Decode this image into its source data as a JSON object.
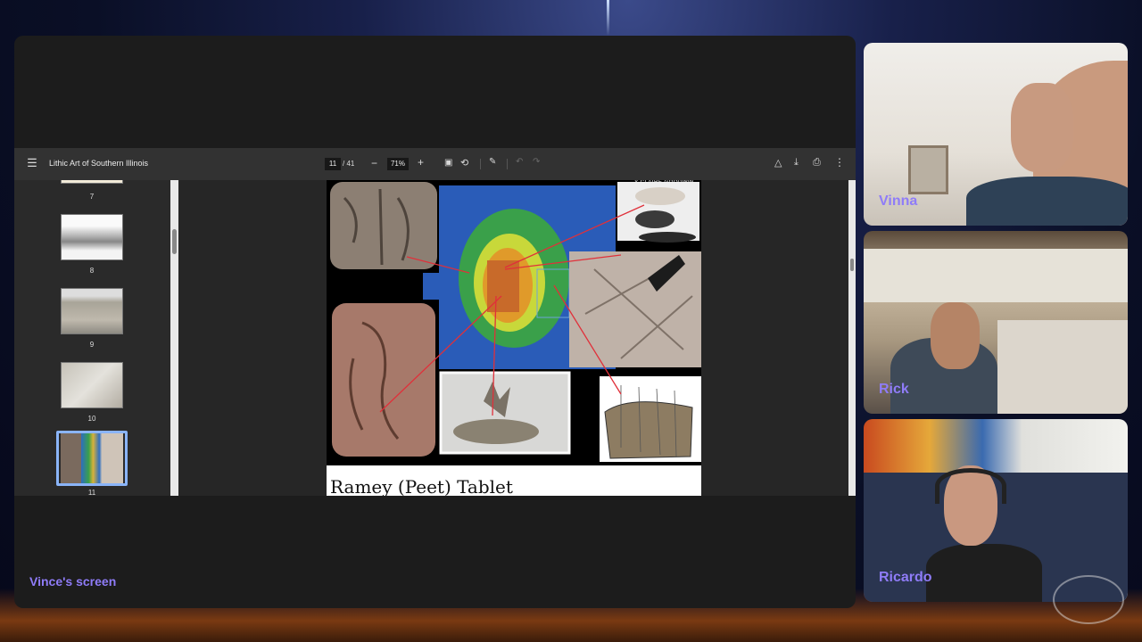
{
  "share": {
    "label": "Vince's screen"
  },
  "pdf": {
    "title": "Lithic Art of Southern Illinois",
    "page_current": "11",
    "page_total": "/ 41",
    "zoom": "71%",
    "thumbnails": [
      {
        "num": "7"
      },
      {
        "num": "8"
      },
      {
        "num": "9"
      },
      {
        "num": "10"
      },
      {
        "num": "11"
      }
    ],
    "page_caption": "Ramey (Peet) Tablet",
    "page_credit": "Y CLAIRE GOODWIN"
  },
  "participants": [
    {
      "name": "Vinna"
    },
    {
      "name": "Rick"
    },
    {
      "name": "Ricardo"
    }
  ],
  "icons": {
    "menu": "menu-icon",
    "zoom_out": "minus-icon",
    "zoom_in": "plus-icon",
    "fit": "fit-page-icon",
    "rotate": "rotate-icon",
    "annotate": "annotate-icon",
    "undo": "undo-icon",
    "redo": "redo-icon",
    "drive": "add-to-drive-icon",
    "download": "download-icon",
    "print": "print-icon",
    "more": "more-vert-icon"
  },
  "colors": {
    "accent_name": "#8f7cf8",
    "selection": "#8ab4f8",
    "toolbar_bg": "#323232"
  }
}
